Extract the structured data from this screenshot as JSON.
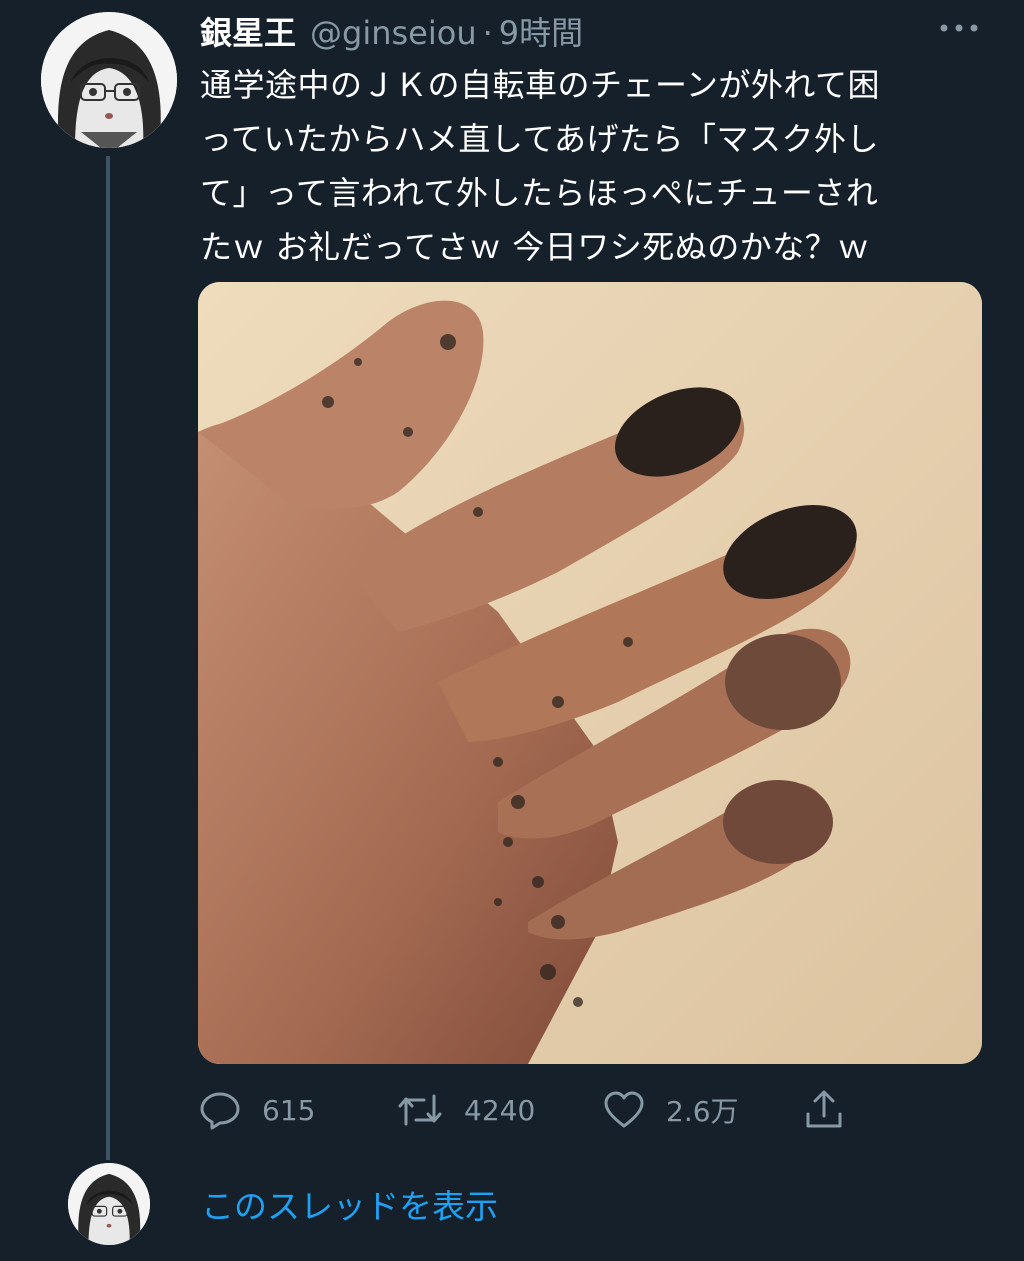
{
  "author": {
    "name": "銀星王",
    "handle": "@ginseiou",
    "separator": "·",
    "time": "9時間"
  },
  "tweet": {
    "lines": [
      "通学途中のＪＫの自転車のチェーンが外れて困",
      "っていたからハメ直してあげたら「マスク外し",
      "て」って言われて外したらほっぺにチューされ",
      "たｗ お礼だってさｗ 今日ワシ死ぬのかな？ｗ"
    ]
  },
  "actions": {
    "reply_count": "615",
    "retweet_count": "4240",
    "like_count": "2.6万"
  },
  "thread": {
    "show_label": "このスレッドを表示"
  },
  "icons": {
    "more": "more-horizontal-icon",
    "reply": "reply-icon",
    "retweet": "retweet-icon",
    "like": "heart-icon",
    "share": "share-icon"
  },
  "colors": {
    "background": "#15202b",
    "secondary_text": "#8899a6",
    "link": "#1da1f2",
    "thread_line": "#3d5466"
  }
}
